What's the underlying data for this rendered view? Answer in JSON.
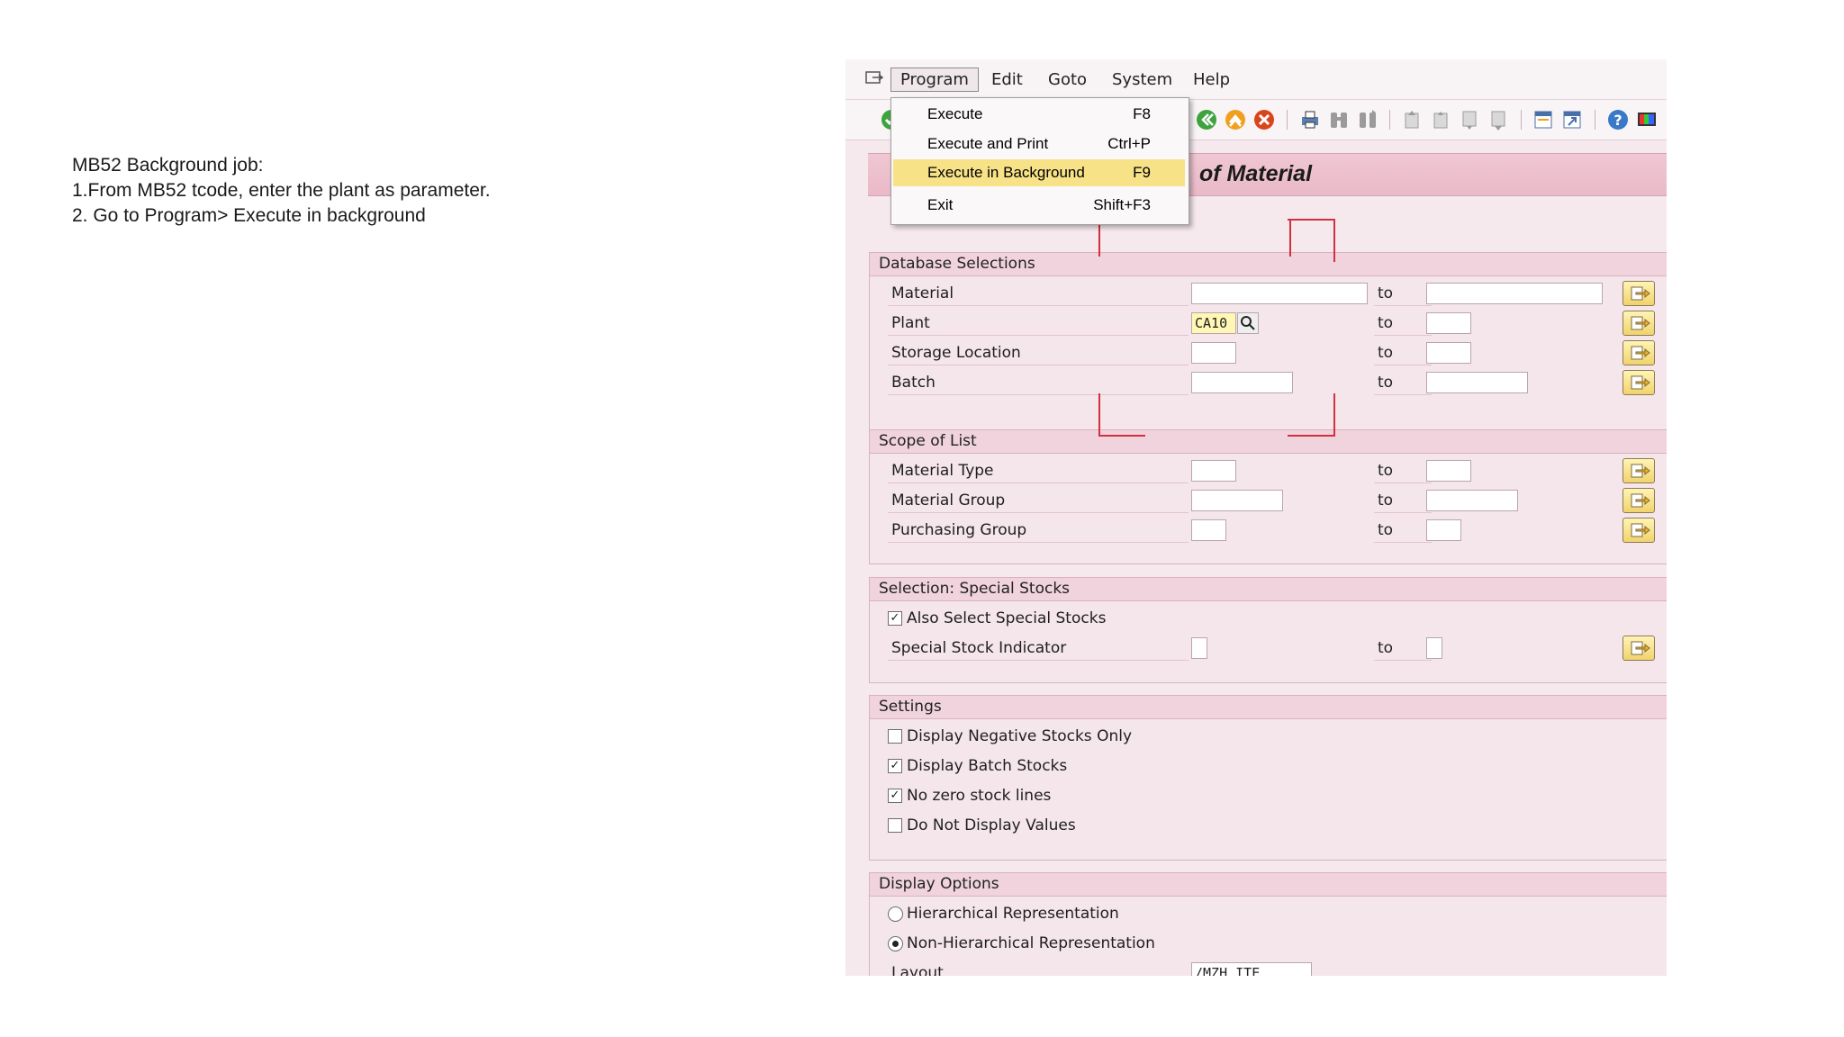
{
  "note": {
    "line1": "MB52 Background job:",
    "line2": "1.From MB52 tcode, enter the plant as parameter.",
    "line3": "2. Go to Program> Execute in background"
  },
  "menubar": {
    "items": [
      {
        "label": "Program"
      },
      {
        "label": "Edit"
      },
      {
        "label": "Goto"
      },
      {
        "label": "System"
      },
      {
        "label": "Help"
      }
    ]
  },
  "program_menu": {
    "items": [
      {
        "label": "Execute",
        "shortcut": "F8"
      },
      {
        "label": "Execute and Print",
        "shortcut": "Ctrl+P"
      },
      {
        "label": "Execute in Background",
        "shortcut": "F9",
        "selected": true
      },
      {
        "label": "Exit",
        "shortcut": "Shift+F3"
      }
    ]
  },
  "title": "of Material",
  "groups": {
    "database": {
      "header": "Database Selections",
      "rows": [
        {
          "label": "Material",
          "from": "",
          "to_label": "to",
          "to": ""
        },
        {
          "label": "Plant",
          "from": "CA10",
          "to_label": "to",
          "to": ""
        },
        {
          "label": "Storage Location",
          "from": "",
          "to_label": "to",
          "to": ""
        },
        {
          "label": "Batch",
          "from": "",
          "to_label": "to",
          "to": ""
        }
      ]
    },
    "scope": {
      "header": "Scope of List",
      "rows": [
        {
          "label": "Material Type",
          "from": "",
          "to_label": "to",
          "to": ""
        },
        {
          "label": "Material Group",
          "from": "",
          "to_label": "to",
          "to": ""
        },
        {
          "label": "Purchasing Group",
          "from": "",
          "to_label": "to",
          "to": ""
        }
      ]
    },
    "special": {
      "header": "Selection: Special Stocks",
      "checkbox_label": "Also Select Special Stocks",
      "checkbox_checked": true,
      "indicator_label": "Special Stock Indicator",
      "to_label": "to"
    },
    "settings": {
      "header": "Settings",
      "options": [
        {
          "label": "Display Negative Stocks Only",
          "checked": false
        },
        {
          "label": "Display Batch Stocks",
          "checked": true
        },
        {
          "label": "No zero stock lines",
          "checked": true
        },
        {
          "label": "Do Not Display Values",
          "checked": false
        }
      ]
    },
    "display": {
      "header": "Display Options",
      "options": [
        {
          "label": "Hierarchical Representation",
          "selected": false
        },
        {
          "label": "Non-Hierarchical Representation",
          "selected": true
        }
      ],
      "layout_label": "Layout",
      "layout_value": "/MZH_ITE"
    }
  },
  "colors": {
    "accent_selected": "#f7e288",
    "title_bar": "#f0c7d3",
    "highlight_red": "#d2303e"
  }
}
